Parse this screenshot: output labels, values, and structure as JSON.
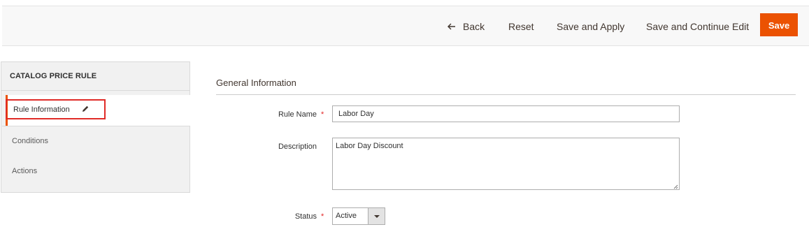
{
  "toolbar": {
    "back_label": "Back",
    "reset_label": "Reset",
    "save_apply_label": "Save and Apply",
    "save_continue_label": "Save and Continue Edit",
    "save_label": "Save"
  },
  "sidebar": {
    "title": "CATALOG PRICE RULE",
    "items": [
      {
        "label": "Rule Information",
        "active": true,
        "icon": "pencil-icon"
      },
      {
        "label": "Conditions",
        "active": false
      },
      {
        "label": "Actions",
        "active": false
      }
    ]
  },
  "main": {
    "section_title": "General Information",
    "fields": {
      "rule_name": {
        "label": "Rule Name",
        "value": "Labor Day",
        "required": true
      },
      "description": {
        "label": "Description",
        "value": "Labor Day Discount",
        "required": false
      },
      "status": {
        "label": "Status",
        "value": "Active",
        "required": true
      }
    }
  },
  "colors": {
    "accent": "#eb5202",
    "highlight_box": "#e02b27",
    "required": "#e22626"
  }
}
